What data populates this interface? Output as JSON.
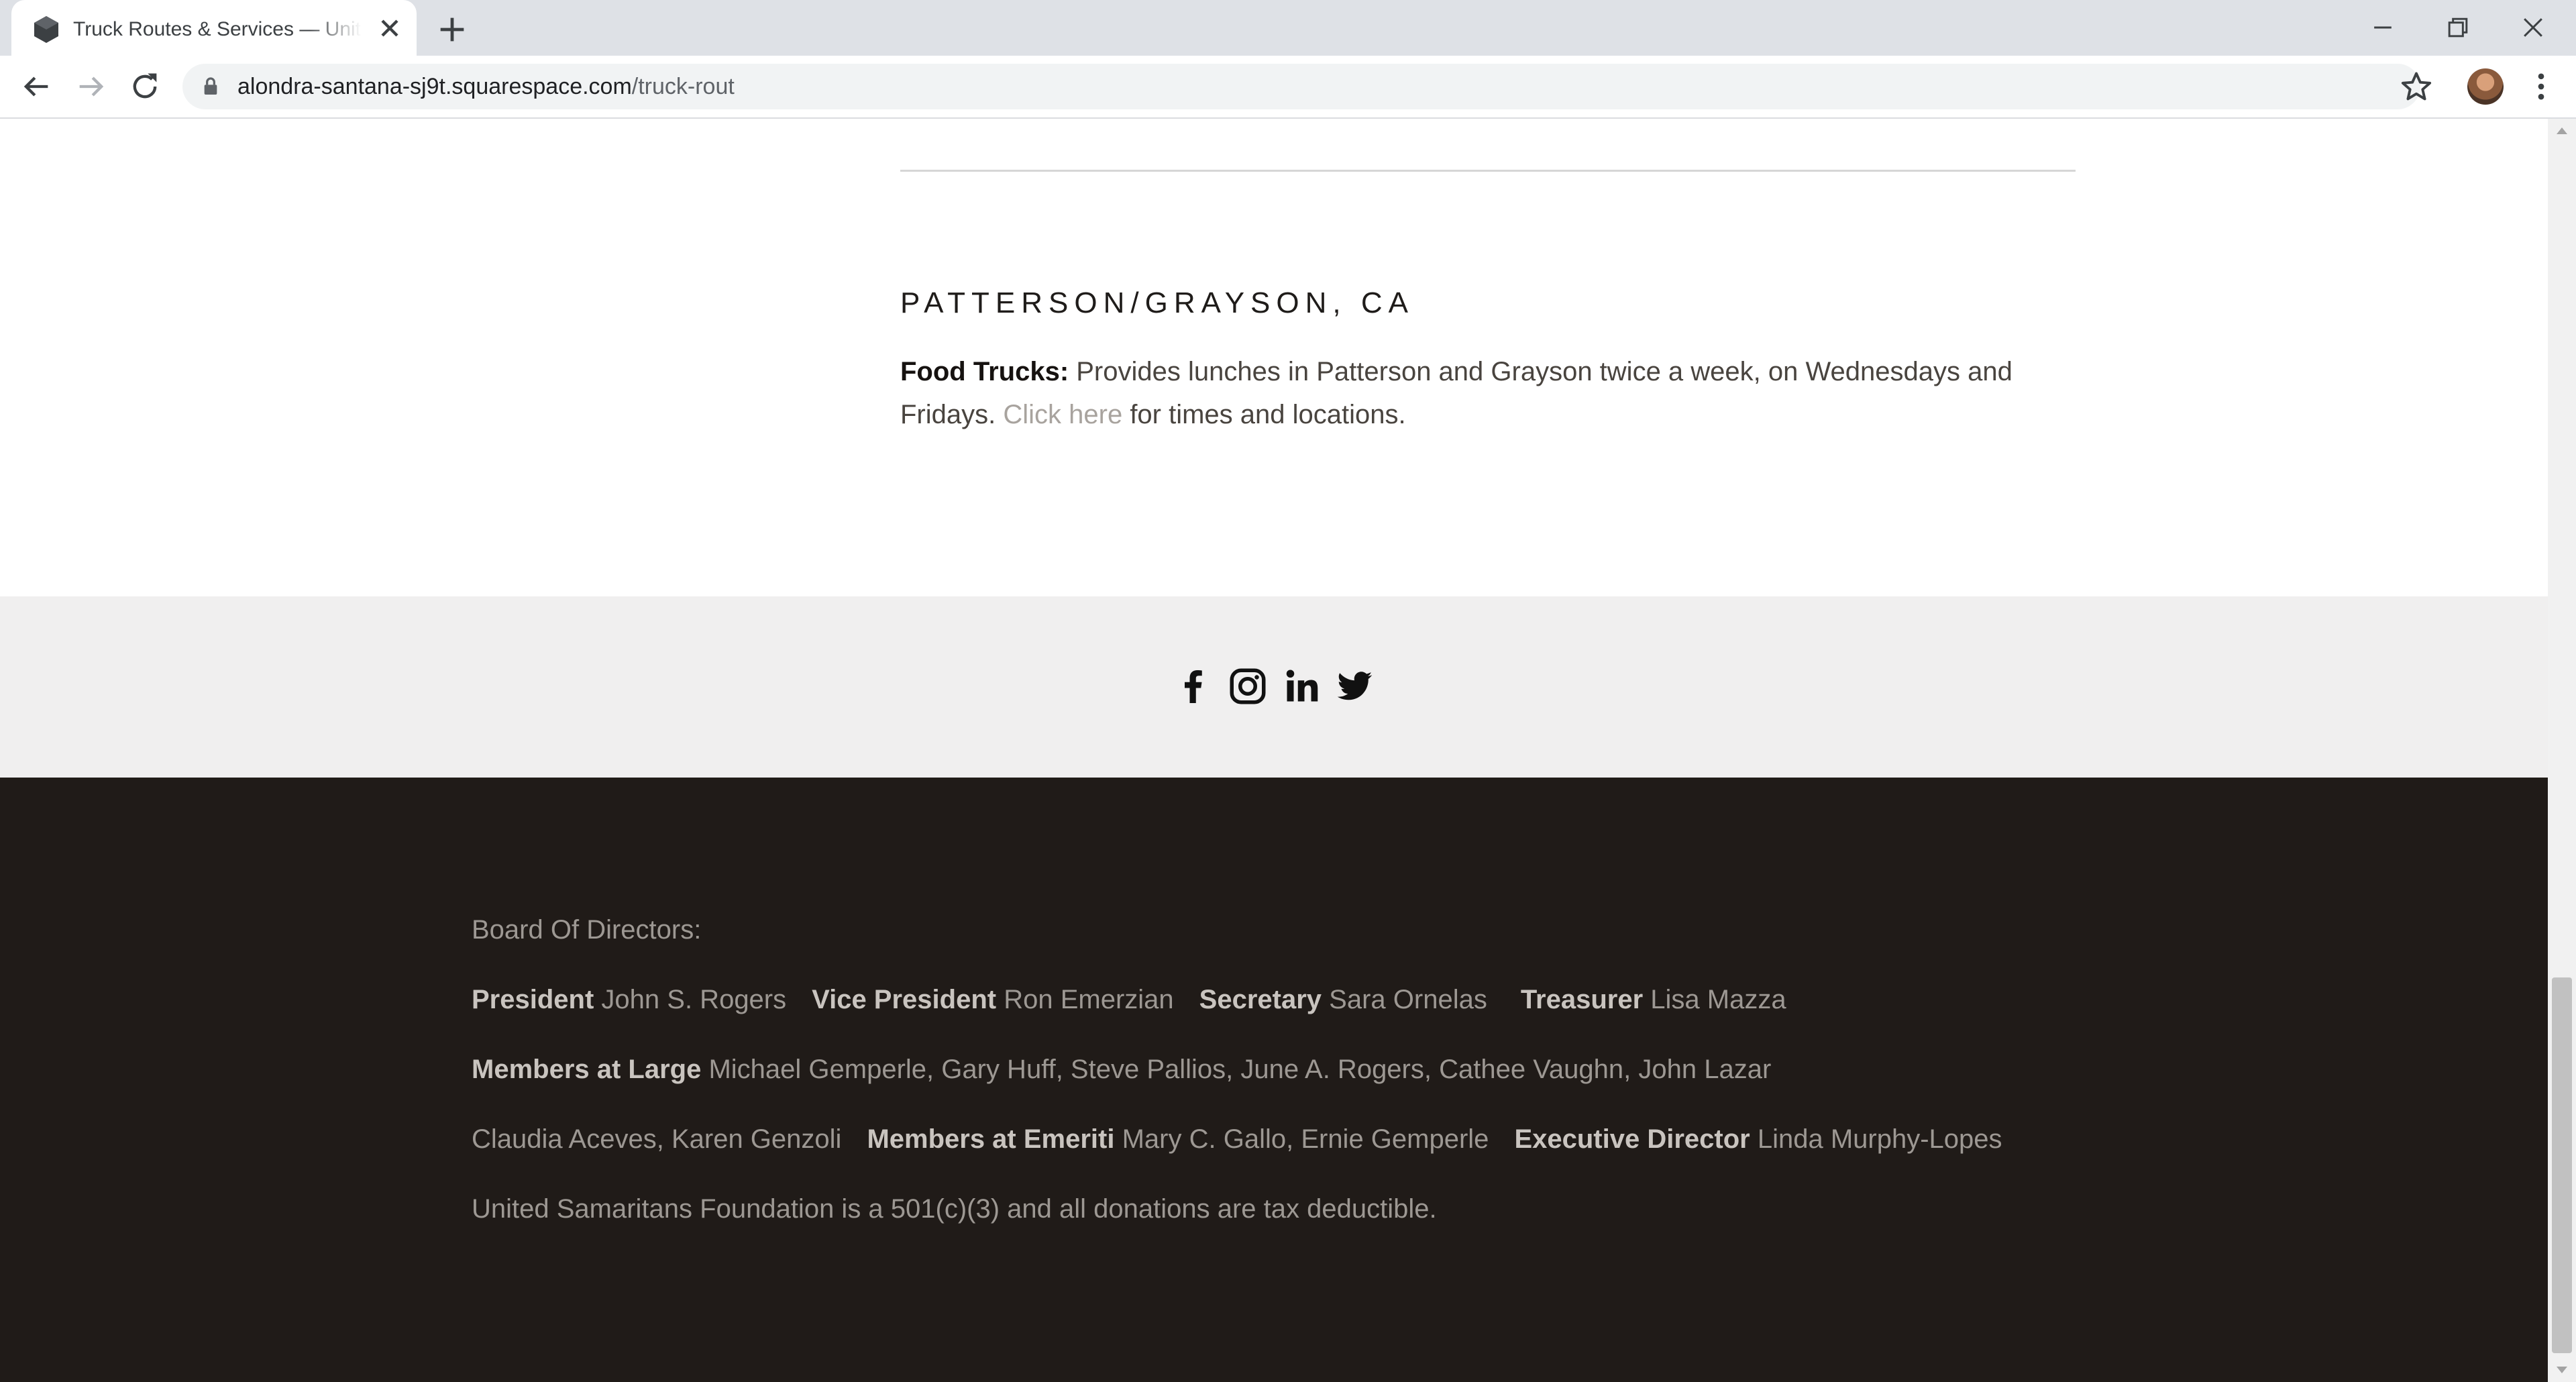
{
  "browser": {
    "tab_title": "Truck Routes & Services — United Samaritans Foundation",
    "url_host": "alondra-santana-sj9t.squarespace.com",
    "url_path": "/truck-rout"
  },
  "section": {
    "heading": "PATTERSON/GRAYSON, CA",
    "body_label": "Food Trucks:",
    "body_text_1": " Provides lunches in Patterson and Grayson twice a week, on Wednesdays and Fridays. ",
    "link_text": "Click here",
    "body_text_2": " for times and locations."
  },
  "social": {
    "icons": [
      "facebook-icon",
      "instagram-icon",
      "linkedin-icon",
      "twitter-icon"
    ]
  },
  "footer": {
    "board_heading": "Board Of Directors:",
    "president_label": "President",
    "president_name": "John S. Rogers",
    "vp_label": "Vice President",
    "vp_name": "Ron Emerzian",
    "secretary_label": "Secretary",
    "secretary_name": "Sara Ornelas",
    "treasurer_label": "Treasurer",
    "treasurer_name": "Lisa Mazza",
    "members_large_label": "Members at Large",
    "members_large_names_1": "Michael Gemperle, Gary Huff, Steve Pallios, June A. Rogers, Cathee Vaughn, John Lazar",
    "members_large_names_2": "Claudia Aceves, Karen Genzoli",
    "emeriti_label": "Members at Emeriti",
    "emeriti_names": "Mary C. Gallo, Ernie Gemperle",
    "exec_label": "Executive Director",
    "exec_name": "Linda Murphy-Lopes",
    "tax_note": "United Samaritans Foundation is a 501(c)(3) and all donations are tax deductible."
  },
  "colors": {
    "footer_bg": "#201b18",
    "social_band_bg": "#f0efef",
    "link": "#a8a39e"
  }
}
